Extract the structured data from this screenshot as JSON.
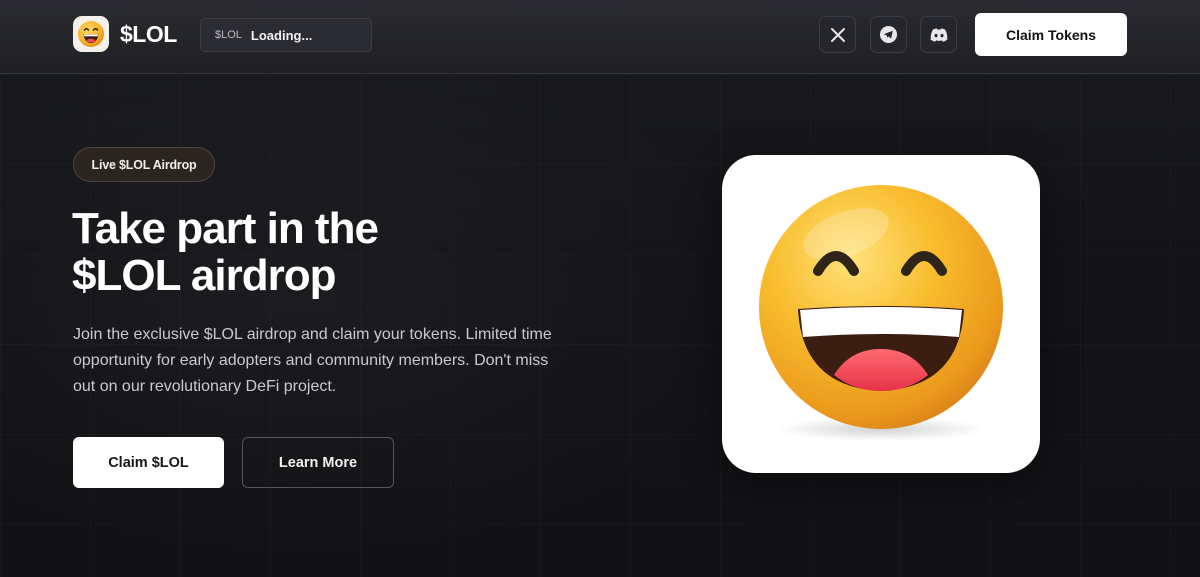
{
  "header": {
    "brand": "$LOL",
    "logo_icon": "laughing-emoji-icon",
    "ticker": {
      "symbol": "$LOL",
      "price": "Loading..."
    },
    "social": [
      {
        "name": "x-icon"
      },
      {
        "name": "telegram-icon"
      },
      {
        "name": "discord-icon"
      }
    ],
    "cta_label": "Claim Tokens"
  },
  "hero": {
    "badge": "Live $LOL Airdrop",
    "headline_line1": "Take part in the",
    "headline_line2": "$LOL airdrop",
    "description": " Join the exclusive $LOL airdrop and claim your tokens. Limited time opportunity for early adopters and community members. Don't miss out on our revolutionary DeFi project.",
    "primary_button": "Claim $LOL",
    "secondary_button": "Learn More",
    "image_icon": "laughing-emoji-icon"
  },
  "colors": {
    "background": "#131316",
    "header": "#24252a",
    "button_primary": "#ffffff",
    "badge_bg": "#2a2520",
    "emoji_yellow": "#f7b628"
  }
}
